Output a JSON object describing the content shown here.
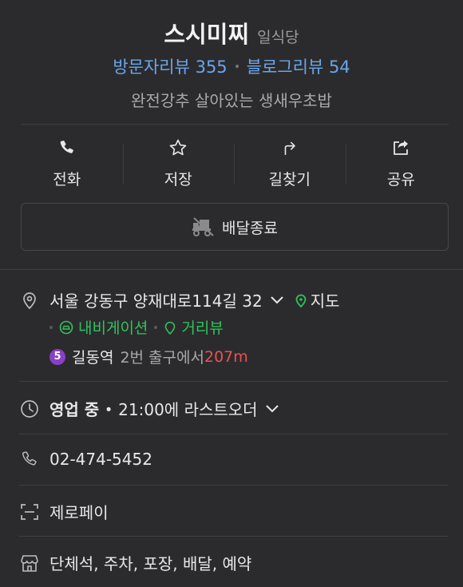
{
  "header": {
    "name": "스시미찌",
    "category": "일식당",
    "visitor_review": "방문자리뷰 355",
    "blog_review": "블로그리뷰 54",
    "tagline": "완전강추 살아있는 생새우초밥"
  },
  "actions": [
    {
      "label": "전화",
      "icon": "phone-icon"
    },
    {
      "label": "저장",
      "icon": "star-icon"
    },
    {
      "label": "길찾기",
      "icon": "directions-icon"
    },
    {
      "label": "공유",
      "icon": "share-icon"
    }
  ],
  "delivery": {
    "label": "배달종료",
    "icon": "delivery-icon"
  },
  "address": {
    "text": "서울 강동구 양재대로114길 32",
    "map_label": "지도",
    "navigation_label": "내비게이션",
    "street_view_label": "거리뷰",
    "subway_line": "5",
    "subway_station": "길동역",
    "exit_text": "2번 출구에서",
    "distance": "207m"
  },
  "hours": {
    "status": "영업 중",
    "separator": "・",
    "detail": "21:00에 라스트오더"
  },
  "phone": {
    "number": "02-474-5452"
  },
  "payment": {
    "label": "제로페이"
  },
  "facilities": {
    "text": "단체석, 주차, 포장, 배달, 예약"
  },
  "colors": {
    "background": "#2b2b2d",
    "link_blue": "#6aa6ec",
    "green": "#2fc35d",
    "red": "#ef5050",
    "line5_purple": "#8a3fc4"
  }
}
